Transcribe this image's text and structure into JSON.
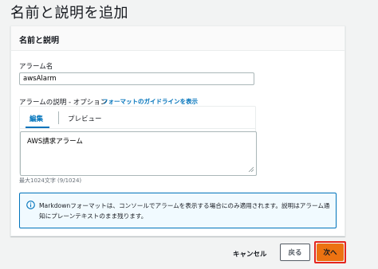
{
  "page": {
    "title": "名前と説明を追加"
  },
  "panel": {
    "title": "名前と説明",
    "alarm_name": {
      "label": "アラーム名",
      "value": "awsAlarm"
    },
    "description": {
      "label": "アラームの説明 - オプション",
      "guideline_link": "フォーマットのガイドラインを表示",
      "tabs": {
        "edit": "編集",
        "preview": "プレビュー"
      },
      "value": "AWS請求アラーム",
      "char_count": "最大1024文字 (9/1024)"
    },
    "info": {
      "text": "Markdownフォーマットは、コンソールでアラームを表示する場合にのみ適用されます。説明はアラーム通知にプレーンテキストのまま残ります。"
    }
  },
  "footer": {
    "cancel": "キャンセル",
    "back": "戻る",
    "next": "次へ"
  },
  "colors": {
    "accent": "#0073bb",
    "primary_button": "#ec7211",
    "highlight_frame": "#e5261f"
  }
}
